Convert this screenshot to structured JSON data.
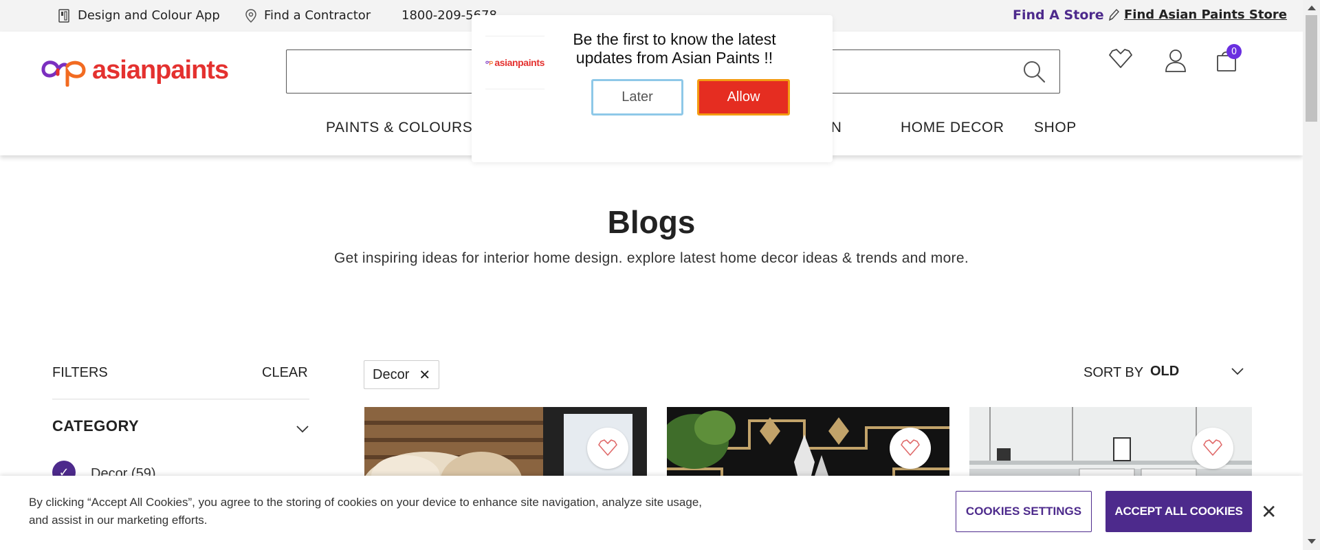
{
  "topbar": {
    "design_app": "Design and Colour App",
    "find_contractor": "Find a Contractor",
    "phone": "1800-209-5678",
    "find_store": "Find A Store",
    "find_ap_store": "Find Asian Paints Store"
  },
  "header": {
    "logo_text": "asianpaints",
    "search_placeholder": "",
    "cart_count": "0",
    "nav": {
      "paints": "PAINTS & COLOURS",
      "partial": "TION",
      "home_decor": "HOME DECOR",
      "shop": "SHOP"
    }
  },
  "page": {
    "title": "Blogs",
    "subtitle": "Get inspiring ideas for interior home design. explore latest home decor ideas & trends and more."
  },
  "filters": {
    "label": "FILTERS",
    "clear": "CLEAR",
    "category_label": "CATEGORY",
    "category_item": "Decor (59)",
    "active_chip": "Decor",
    "chip_close": "✕"
  },
  "sort": {
    "label": "SORT BY",
    "value": "OLD"
  },
  "notification": {
    "logo_text": "asianpaints",
    "message": "Be the first to know the latest updates from Asian Paints !!",
    "later": "Later",
    "allow": "Allow"
  },
  "cookie": {
    "text": "By clicking “Accept All Cookies”, you agree to the storing of cookies on your device to enhance site navigation, analyze site usage, and assist in our marketing efforts.",
    "settings": "COOKIES SETTINGS",
    "accept": "ACCEPT ALL COOKIES",
    "close": "✕"
  },
  "colors": {
    "brand_red": "#e4312f",
    "brand_purple": "#4d2a8c",
    "allow_red": "#e52d21",
    "badge_purple": "#6a2fe0"
  },
  "icons": [
    "phone-app-icon",
    "location-pin-icon",
    "pencil-icon",
    "search-icon",
    "wishlist-heart-icon",
    "user-icon",
    "cart-icon",
    "chevron-down-icon",
    "checkmark-icon",
    "close-icon"
  ]
}
